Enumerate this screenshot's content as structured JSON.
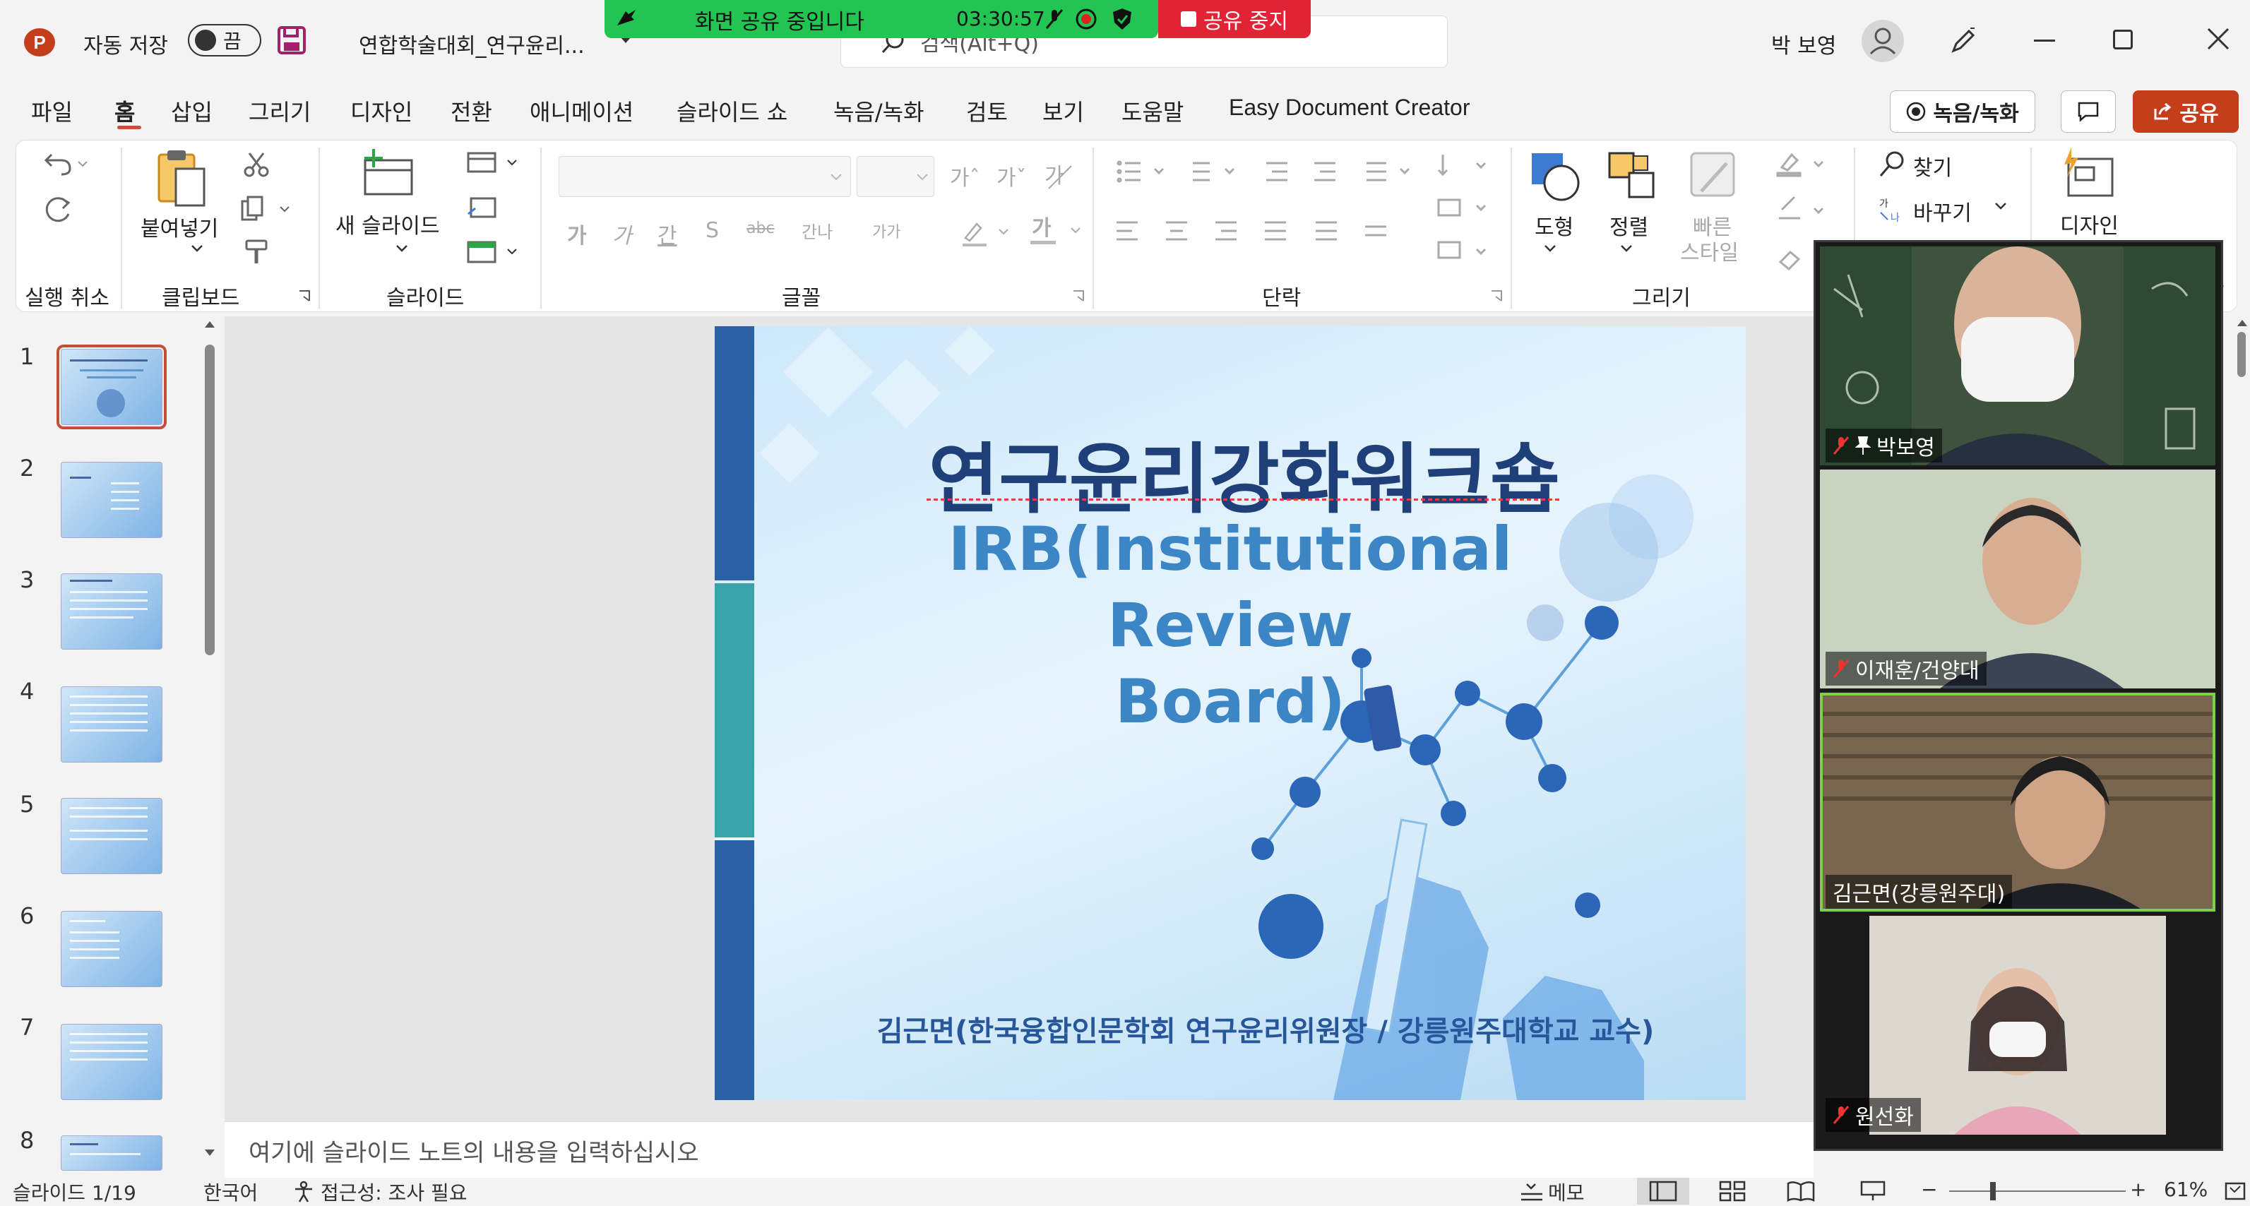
{
  "titlebar": {
    "autosave_label": "자동 저장",
    "autosave_state": "끔",
    "file_title": "연합학술대회_연구윤리...",
    "search_placeholder": "검색(Alt+Q)",
    "user_name": "박 보영"
  },
  "share": {
    "status": "화면 공유 중입니다",
    "timer": "03:30:57",
    "stop_label": "공유 중지"
  },
  "menu": {
    "items": [
      "파일",
      "홈",
      "삽입",
      "그리기",
      "디자인",
      "전환",
      "애니메이션",
      "슬라이드 쇼",
      "녹음/녹화",
      "검토",
      "보기",
      "도움말",
      "Easy Document Creator"
    ],
    "active": "홈",
    "record_button": "녹음/녹화",
    "share_button": "공유"
  },
  "ribbon": {
    "groups": {
      "undo": "실행 취소",
      "clipboard": "클립보드",
      "slides": "슬라이드",
      "font": "글꼴",
      "paragraph": "단락",
      "drawing": "그리기"
    },
    "paste": "붙여넣기",
    "new_slide": "새 슬라이드",
    "shape": "도형",
    "arrange": "정렬",
    "quick_style_1": "빠른",
    "quick_style_2": "스타일",
    "find": "찾기",
    "replace": "바꾸기",
    "designer": "디자인",
    "font_buttons": [
      "가",
      "가",
      "간",
      "S",
      "abc",
      "간나",
      "가가"
    ]
  },
  "slides": {
    "numbers": [
      "1",
      "2",
      "3",
      "4",
      "5",
      "6",
      "7",
      "8"
    ],
    "selected": 1
  },
  "slide": {
    "title": "연구윤리강화워크숍",
    "subtitle_line1": "IRB(Institutional Review",
    "subtitle_line2": "Board)",
    "author": "김근면(한국융합인문학회 연구윤리위원장 / 강릉원주대학교 교수)"
  },
  "notes_placeholder": "여기에 슬라이드 노트의 내용을 입력하십시오",
  "participants": [
    {
      "name": "박보영"
    },
    {
      "name": "이재훈/건양대"
    },
    {
      "name": "김근면(강릉원주대)"
    },
    {
      "name": "원선화"
    }
  ],
  "statusbar": {
    "slide_indicator": "슬라이드 1/19",
    "language": "한국어",
    "accessibility": "접근성: 조사 필요",
    "notes_button": "메모",
    "zoom": "61%"
  },
  "colors": {
    "accent": "#c44e3a",
    "share_green": "#23c552",
    "share_red": "#e02436",
    "record_red": "#c43e1c"
  }
}
